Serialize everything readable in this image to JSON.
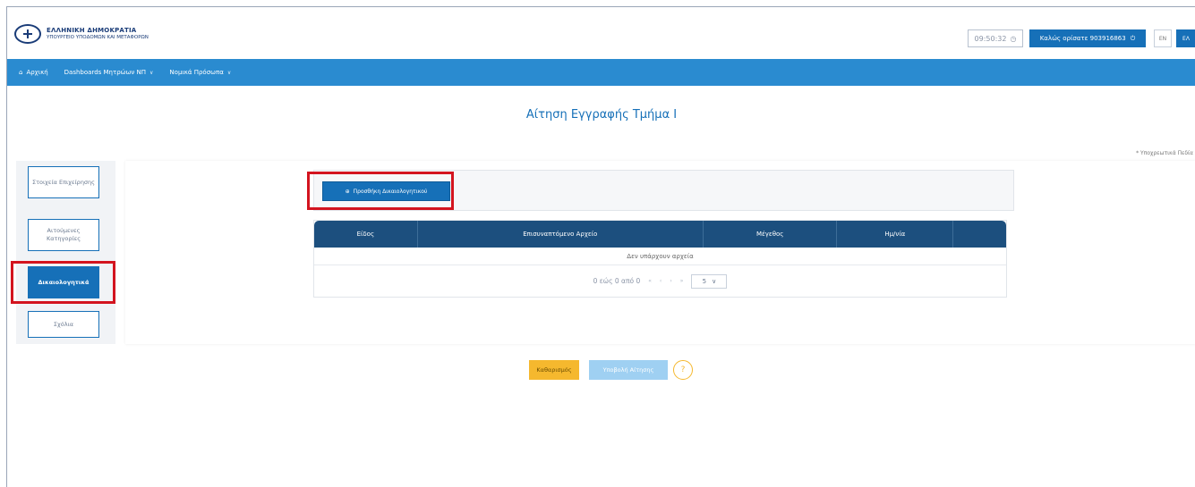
{
  "header": {
    "org_line1": "ΕΛΛΗΝΙΚΗ ΔΗΜΟΚΡΑΤΙΑ",
    "org_line2": "ΥΠΟΥΡΓΕΙΟ ΥΠΟΔΟΜΩΝ ΚΑΙ ΜΕΤΑΦΟΡΩΝ",
    "session_timer": "09:50:32",
    "welcome": "Καλώς ορίσατε 903916863",
    "lang_en": "EN",
    "lang_el": "ΕΛ"
  },
  "nav": {
    "home": "Αρχική",
    "dashboards": "Dashboards Μητρώων ΝΠ",
    "legal_entities": "Νομικά Πρόσωπα"
  },
  "page": {
    "title": "Αίτηση Εγγραφής Τμήμα Ι",
    "required_note": "* Υποχρεωτικά Πεδία"
  },
  "sidebar": {
    "items": [
      {
        "label": "Στοιχεία Επιχείρησης"
      },
      {
        "label": "Αιτούμενες Κατηγορίες"
      },
      {
        "label": "Δικαιολογητικά"
      },
      {
        "label": "Σχόλια"
      }
    ]
  },
  "documents": {
    "add_button": "Προσθήκη Δικαιολογητικού",
    "columns": [
      "Είδος",
      "Επισυναπτόμενο Αρχείο",
      "Μέγεθος",
      "Ημ/νία",
      ""
    ],
    "empty_message": "Δεν υπάρχουν αρχεία",
    "pagination_text": "0 εώς 0 από 0",
    "page_size": "5"
  },
  "actions": {
    "clear": "Καθαρισμός",
    "submit": "Υποβολή Αίτησης",
    "help": "?"
  },
  "colors": {
    "primary": "#1670b8",
    "nav": "#2a8bd0",
    "table_header": "#1c4f7e",
    "highlight": "#d3141f",
    "clear_button": "#f5b82e",
    "submit_disabled": "#9fd0f2"
  },
  "icons": {
    "emblem": "greek-emblem-icon",
    "timer": "clock-icon",
    "logout": "power-icon",
    "home": "home-icon",
    "add": "plus-circle-icon"
  }
}
